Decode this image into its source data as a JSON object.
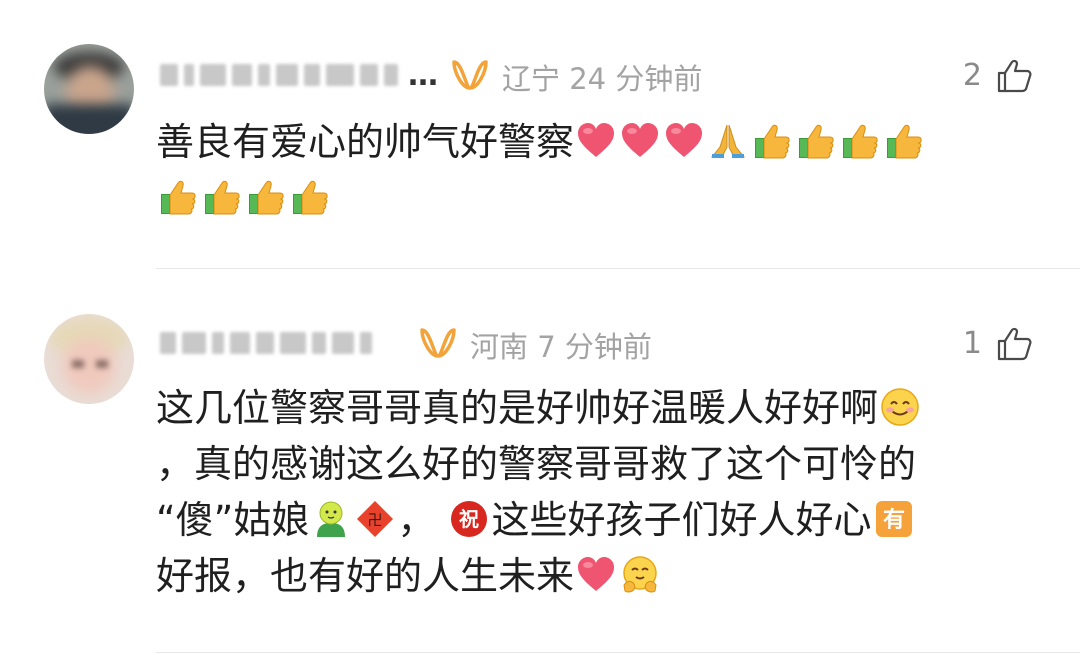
{
  "comments": [
    {
      "username_masked": "…",
      "location": "辽宁",
      "time": "24 分钟前",
      "likes": "2",
      "text": "善良有爱心的帅气好警察",
      "emojis": [
        "heart-icon",
        "heart-icon",
        "heart-icon",
        "pray-icon",
        "thumbs-up-icon",
        "thumbs-up-icon",
        "thumbs-up-icon",
        "thumbs-up-icon",
        "thumbs-up-icon",
        "thumbs-up-icon",
        "thumbs-up-icon",
        "thumbs-up-icon"
      ]
    },
    {
      "username_masked": "",
      "location": "河南",
      "time": "7 分钟前",
      "likes": "1",
      "text_line1": "这几位警察哥哥真的是好帅好温暖人好好啊",
      "text_line2": "，真的感谢这么好的警察哥哥救了这个可怜的",
      "text_line3a": "“傻”姑娘",
      "text_line3b": "，",
      "text_line3c": "这些好孩子们好人好心",
      "text_line4": "好报，也有好的人生未来",
      "emojis": [
        "smile-icon",
        "kid-icon",
        "fu-diamond-icon",
        "zhu-badge-icon",
        "you-badge-icon",
        "heart-icon",
        "hug-icon"
      ]
    }
  ],
  "colors": {
    "meta": "#a3a3a3",
    "heart": "#f0506e",
    "badge": "#f0a500",
    "text": "#1f1f1f"
  }
}
